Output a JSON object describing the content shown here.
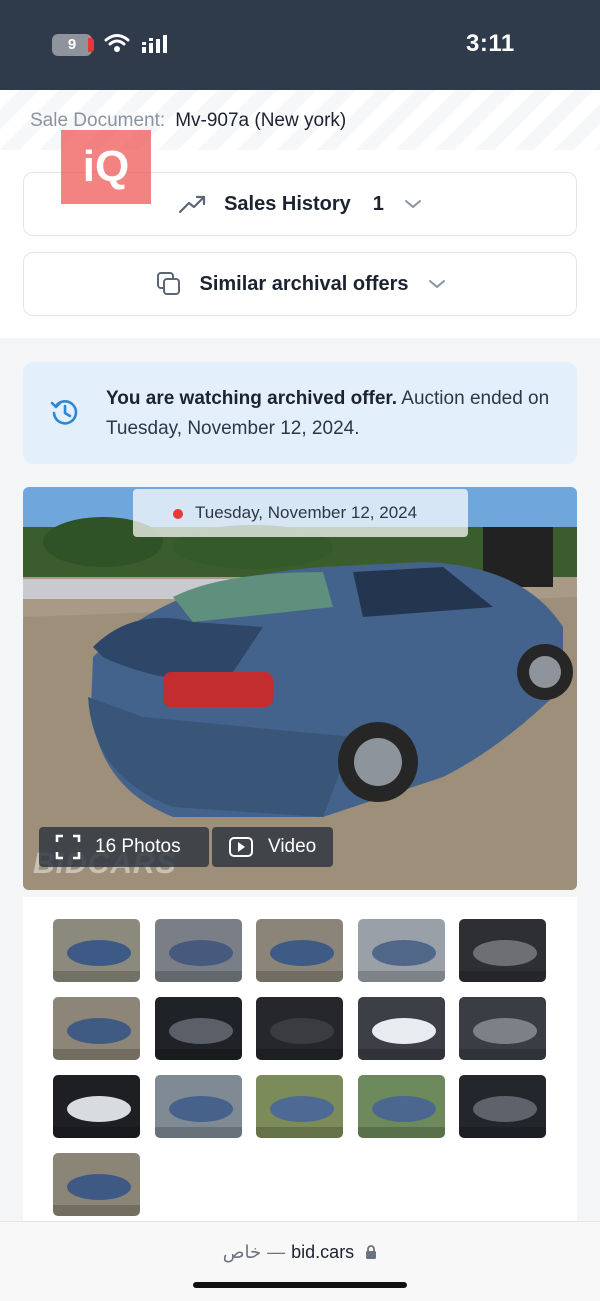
{
  "status_bar": {
    "time": "3:11",
    "battery_level": "9"
  },
  "sale_document": {
    "label": "Sale Document:",
    "value": "Mv-907a (New york)"
  },
  "watermark_logo": "iQ",
  "sales_history": {
    "label": "Sales History",
    "count": "1"
  },
  "similar_offers": {
    "label": "Similar archival offers"
  },
  "notice": {
    "bold": "You are watching archived offer.",
    "rest": " Auction ended on Tuesday, November 12, 2024."
  },
  "main_photo": {
    "date": "Tuesday, November 12, 2024",
    "photos_button": "16 Photos",
    "video_button": "Video",
    "watermark": "BIDCARS"
  },
  "url_bar": {
    "private_label": "خاص",
    "separator": "—",
    "domain": "bid.cars"
  },
  "colors": {
    "status_bar": "#2f3a4a",
    "notice_bg": "#e3f0fb",
    "accent_blue": "#2e87d1",
    "date_dot": "#e53935"
  },
  "icons": {
    "sales_history": "trending-up-icon",
    "similar_offers": "copy-icon",
    "notice": "history-icon",
    "photos": "expand-icon",
    "video": "video-icon",
    "url": "lock-icon"
  }
}
